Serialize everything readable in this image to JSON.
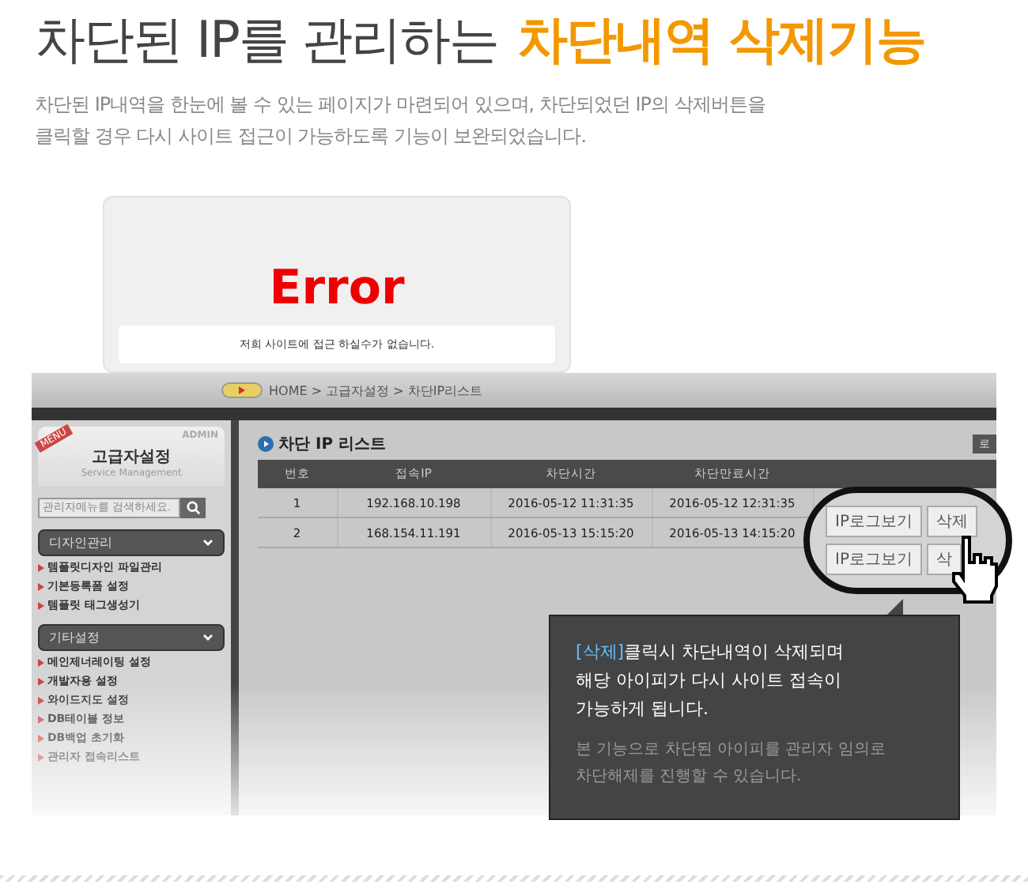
{
  "headline": {
    "text": "차단된 IP를 관리하는",
    "highlight": "차단내역 삭제기능"
  },
  "description": [
    "차단된 IP내역을 한눈에 볼 수 있는 페이지가 마련되어 있으며, 차단되었던 IP의 삭제버튼을",
    "클릭할 경우 다시 사이트 접근이 가능하도록 기능이 보완되었습니다."
  ],
  "error_page": {
    "title": "Error",
    "message": "저희 사이트에 접근 하실수가 없습니다."
  },
  "admin": {
    "breadcrumb": "HOME > 고급자설정 > 차단IP리스트",
    "ribbon": "MENU",
    "badge": "ADMIN",
    "sidebar_title": "고급자설정",
    "sidebar_subtitle": "Service Management",
    "search": {
      "placeholder": "관리자메뉴를 검색하세요."
    },
    "menu_groups": [
      {
        "label": "디자인관리",
        "items": [
          "템플릿디자인 파일관리",
          "기본등록폼 설정",
          "템플릿 태그생성기"
        ]
      },
      {
        "label": "기타설정",
        "items": [
          "메인제너레이팅 설정",
          "개발자용 설정",
          "와이드지도 설정",
          "DB테이블 정보",
          "DB백업 초기화",
          "관리자 접속리스트"
        ]
      }
    ],
    "list_title": "차단 IP 리스트",
    "top_button": "로",
    "table": {
      "columns": [
        "번호",
        "접속IP",
        "차단시간",
        "차단만료시간"
      ],
      "rows": [
        {
          "cells": [
            "1",
            "192.168.10.198",
            "2016-05-12 11:31:35",
            "2016-05-12 12:31:35"
          ]
        },
        {
          "cells": [
            "2",
            "168.154.11.191",
            "2016-05-13 15:15:20",
            "2016-05-13 14:15:20"
          ]
        }
      ]
    }
  },
  "callout_buttons": [
    {
      "log": "IP로그보기",
      "delete": "삭제"
    },
    {
      "log": "IP로그보기",
      "delete": "삭"
    }
  ],
  "tooltip": {
    "highlight": "[삭제]",
    "lines": [
      "클릭시 차단내역이 삭제되며",
      "해당 아이피가 다시 사이트 접속이",
      "가능하게 됩니다."
    ],
    "note": [
      "본 기능으로 차단된 아이피를 관리자 임의로",
      "차단해제를 진행할 수 있습니다."
    ]
  }
}
